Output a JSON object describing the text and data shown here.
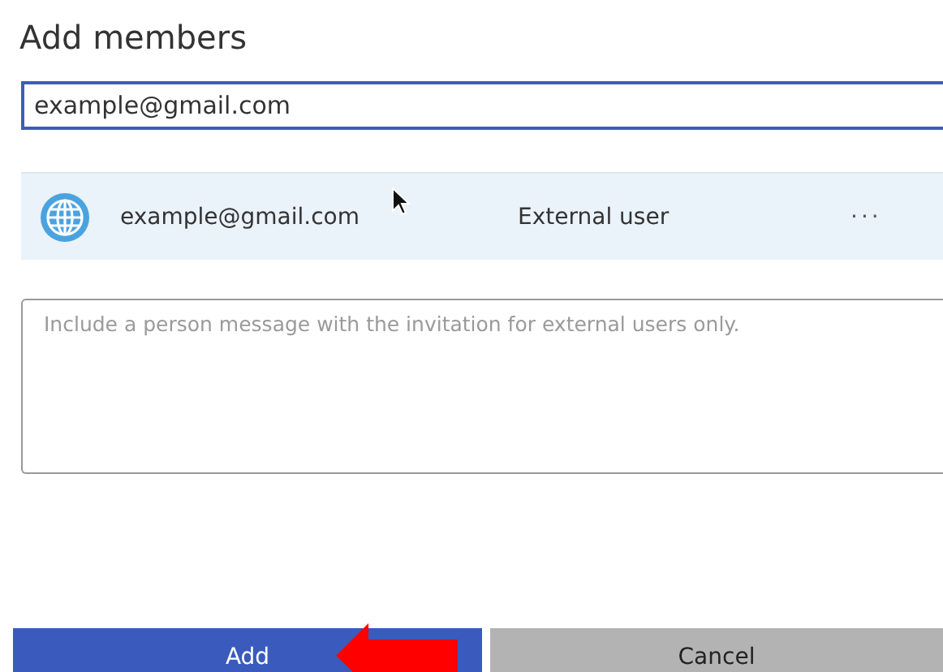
{
  "dialog": {
    "title": "Add members"
  },
  "search_field": {
    "value": "example@gmail.com"
  },
  "members": [
    {
      "email": "example@gmail.com",
      "type": "External user",
      "more": "···",
      "selected": true
    }
  ],
  "message_field": {
    "placeholder": "Include a person message with the invitation for external users only."
  },
  "buttons": [
    {
      "label": "Add",
      "kind": "primary"
    },
    {
      "label": "Cancel",
      "kind": "secondary"
    }
  ]
}
